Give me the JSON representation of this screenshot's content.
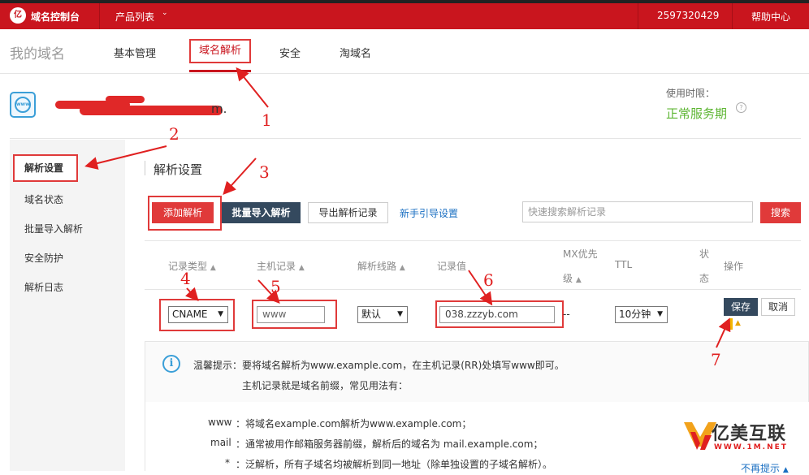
{
  "topbar": {
    "logo_text": "亿",
    "title": "域名控制台",
    "products": "产品列表",
    "account": "2597320429",
    "help": "帮助中心"
  },
  "nav": {
    "site_title": "我的域名",
    "tabs": [
      "基本管理",
      "域名解析",
      "安全",
      "淘域名"
    ]
  },
  "info": {
    "domain_icon": "www",
    "domain_suffix": "m.",
    "expiry_label": "使用时限：",
    "expiry_value": "正常服务期",
    "status_color": "#5cb531"
  },
  "sidebar": {
    "items": [
      "解析设置",
      "域名状态",
      "批量导入解析",
      "安全防护",
      "解析日志"
    ]
  },
  "section": {
    "title": "解析设置"
  },
  "toolbar": {
    "add": "添加解析",
    "batch": "批量导入解析",
    "export": "导出解析记录",
    "guide": "新手引导设置",
    "search_placeholder": "快速搜索解析记录",
    "search": "搜索"
  },
  "table": {
    "headers": {
      "type": "记录类型",
      "host": "主机记录",
      "line": "解析线路",
      "value": "记录值",
      "mx_a": "MX优先",
      "mx_b": "级",
      "ttl": "TTL",
      "status_a": "状",
      "status_b": "态",
      "ops": "操作"
    },
    "row": {
      "type": "CNAME",
      "host": "www",
      "line": "默认",
      "value": "038.zzzyb.com",
      "mx": "--",
      "ttl": "10分钟",
      "save": "保存",
      "cancel": "取消"
    }
  },
  "tip": {
    "icon": "i",
    "line1": "温馨提示：要将域名解析为www.example.com，在主机记录(RR)处填写www即可。",
    "line2": "主机记录就是域名前缀，常见用法有：",
    "examples": [
      {
        "key": "www",
        "desc": "：将域名example.com解析为www.example.com；"
      },
      {
        "key": "mail",
        "desc": "：通常被用作邮箱服务器前缀，解析后的域名为 mail.example.com；"
      },
      {
        "key": "*",
        "desc": "：泛解析，所有子域名均被解析到同一地址（除单独设置的子域名解析）。"
      }
    ],
    "hide": "不再提示"
  },
  "annotations": [
    "1",
    "2",
    "3",
    "4",
    "5",
    "6",
    "7"
  ],
  "watermark": {
    "text": "亿美互联",
    "url": "WWW.1M.NET"
  },
  "colors": {
    "brand_red": "#c9151e",
    "dark_button": "#34495e",
    "annotation_red": "#e02020"
  }
}
